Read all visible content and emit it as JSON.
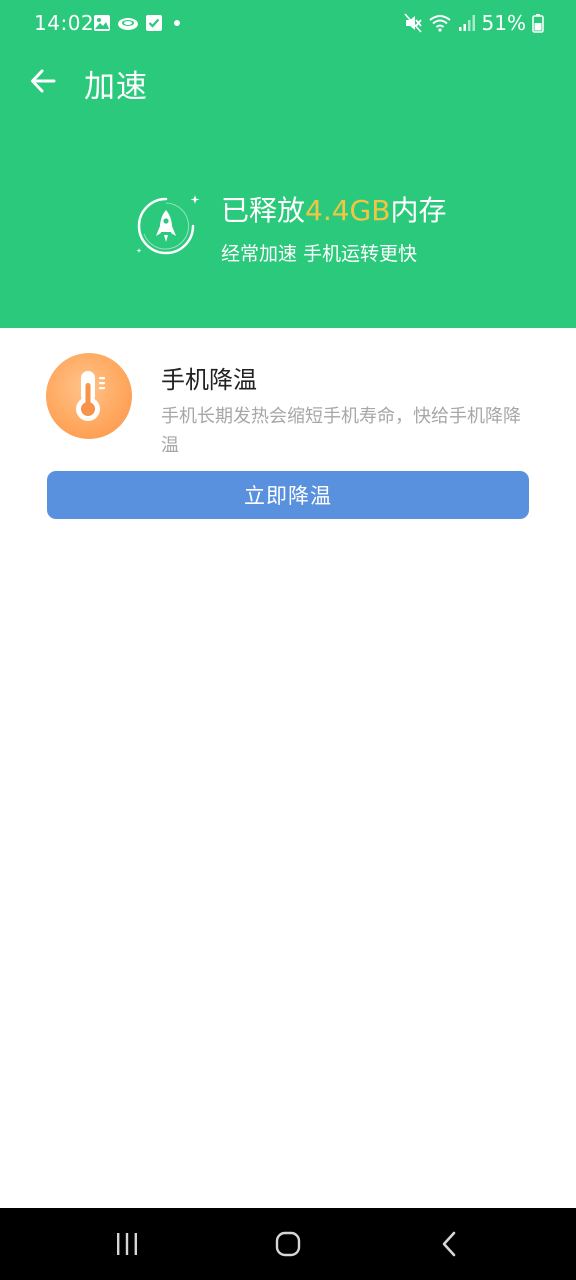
{
  "status_bar": {
    "time": "14:02",
    "battery": "51%",
    "left_icons": [
      "gallery-icon",
      "cloud-icon",
      "checkbox-icon",
      "dot-icon"
    ],
    "right_icons": [
      "mute-icon",
      "wifi-icon",
      "signal-icon",
      "battery-icon"
    ]
  },
  "app_bar": {
    "title": "加速",
    "back_icon": "arrow-left-icon"
  },
  "summary": {
    "prefix": "已释放",
    "amount": "4.4GB",
    "suffix": "内存",
    "subtitle": "经常加速 手机运转更快",
    "icon": "rocket-icon"
  },
  "cooling_card": {
    "icon": "thermometer-icon",
    "title": "手机降温",
    "description": "手机长期发热会缩短手机寿命，快给手机降降温",
    "button_label": "立即降温"
  },
  "nav_bar": {
    "items": [
      "recents-icon",
      "home-icon",
      "back-icon"
    ]
  },
  "colors": {
    "header_bg": "#2bc97c",
    "amount_accent": "#f4c542",
    "button_bg": "#5a91df",
    "card_icon_bg": "#ffa65c"
  }
}
